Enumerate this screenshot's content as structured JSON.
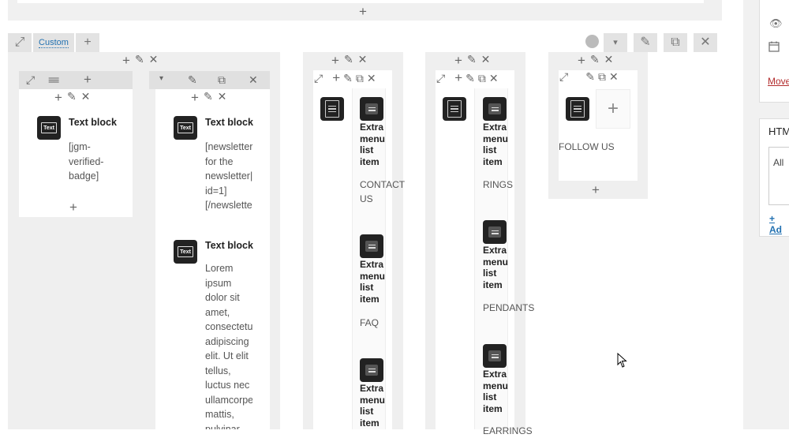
{
  "top_row": {
    "add_icon": "+"
  },
  "row": {
    "custom_label": "Custom",
    "add_icon": "+",
    "menu_icon": "▾",
    "edit_icon": "✎",
    "duplicate_icon": "⧉",
    "delete_icon": "✕"
  },
  "column_controls": {
    "add": "+",
    "edit": "✎",
    "delete": "✕",
    "expand": "⤢",
    "drag": "≡≡"
  },
  "col1": {
    "element": {
      "title": "Text block",
      "content": [
        "[jgm-",
        "verified-",
        "badge]"
      ]
    }
  },
  "col2": {
    "element1": {
      "title": "Text block",
      "content": [
        "[newsletter",
        "for the",
        "newsletter|",
        "id=1]",
        "[/newslette"
      ]
    },
    "element2": {
      "title": "Text block",
      "content": [
        "Lorem",
        "ipsum",
        "dolor sit",
        "amet,",
        "consectetu",
        "adipiscing",
        "elit. Ut elit",
        "tellus,",
        "luctus nec",
        "ullamcorpe",
        "mattis,",
        "pulvinar"
      ]
    }
  },
  "col3": {
    "items": [
      {
        "title": [
          "Extra",
          "menu",
          "list",
          "item"
        ],
        "label": [
          "CONTACT",
          "US"
        ]
      },
      {
        "title": [
          "Extra",
          "menu",
          "list",
          "item"
        ],
        "label": [
          "FAQ"
        ]
      },
      {
        "title": [
          "Extra",
          "menu",
          "list",
          "item"
        ],
        "label": []
      }
    ]
  },
  "col4": {
    "items": [
      {
        "title": [
          "Extra",
          "menu",
          "list",
          "item"
        ],
        "label": [
          "RINGS"
        ]
      },
      {
        "title": [
          "Extra",
          "menu",
          "list",
          "item"
        ],
        "label": [
          "PENDANTS"
        ]
      },
      {
        "title": [
          "Extra",
          "menu",
          "list",
          "item"
        ],
        "label": [
          "EARRINGS"
        ]
      }
    ]
  },
  "col5": {
    "label": "FOLLOW US"
  },
  "right_panel": {
    "move_link": "Move",
    "html_widget_title": "HTML",
    "html_text": "All",
    "add_link": "+ Ad"
  },
  "colors": {
    "link": "#2271b1",
    "trash": "#b32d2e",
    "icon_bg": "#222222"
  }
}
